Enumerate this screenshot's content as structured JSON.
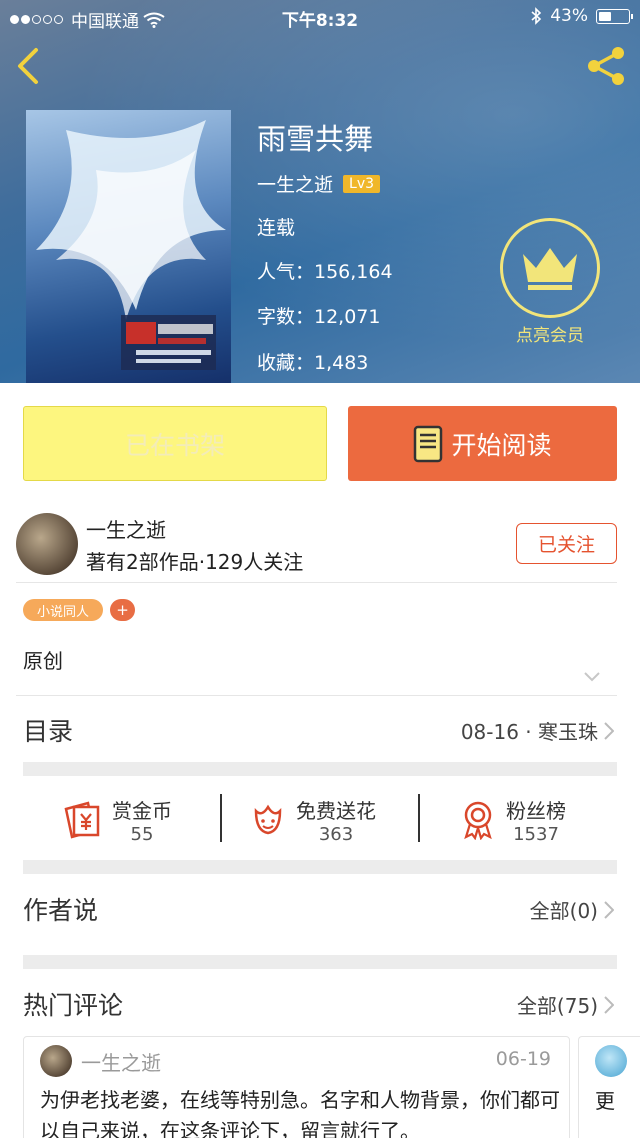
{
  "status_bar": {
    "carrier": "中国联通",
    "time": "下午8:32",
    "battery": "43%"
  },
  "book": {
    "title": "雨雪共舞",
    "author": "一生之逝",
    "level": "Lv3",
    "status": "连载",
    "popularity": "人气：156,164",
    "word_count": "字数：12,071",
    "favorites": "收藏：1,483"
  },
  "vip": {
    "label": "点亮会员"
  },
  "actions": {
    "shelf_label": "已在书架",
    "read_label": "开始阅读"
  },
  "author": {
    "name": "一生之逝",
    "stats": "著有2部作品·129人关注",
    "follow_label": "已关注"
  },
  "tags": {
    "category": "小说同人",
    "add": "+"
  },
  "description": "原创",
  "toc": {
    "title": "目录",
    "latest": "08-16 · 寒玉珠"
  },
  "stats": [
    {
      "label": "赏金币",
      "value": "55"
    },
    {
      "label": "免费送花",
      "value": "363"
    },
    {
      "label": "粉丝榜",
      "value": "1537"
    }
  ],
  "author_says": {
    "title": "作者说",
    "all": "全部(0)"
  },
  "hot_comments": {
    "title": "热门评论",
    "all": "全部(75)",
    "items": [
      {
        "user": "一生之逝",
        "date": "06-19",
        "text": "为伊老找老婆，在线等特别急。名字和人物背景，你们都可以自己来说，在这条评论下，留言就行了。"
      },
      {
        "text": "更"
      }
    ]
  },
  "colors": {
    "accent_orange": "#ec6a3f",
    "shelf_yellow": "#fdf67f",
    "vip_gold": "#f2e57a",
    "follow_red": "#e5532f"
  }
}
